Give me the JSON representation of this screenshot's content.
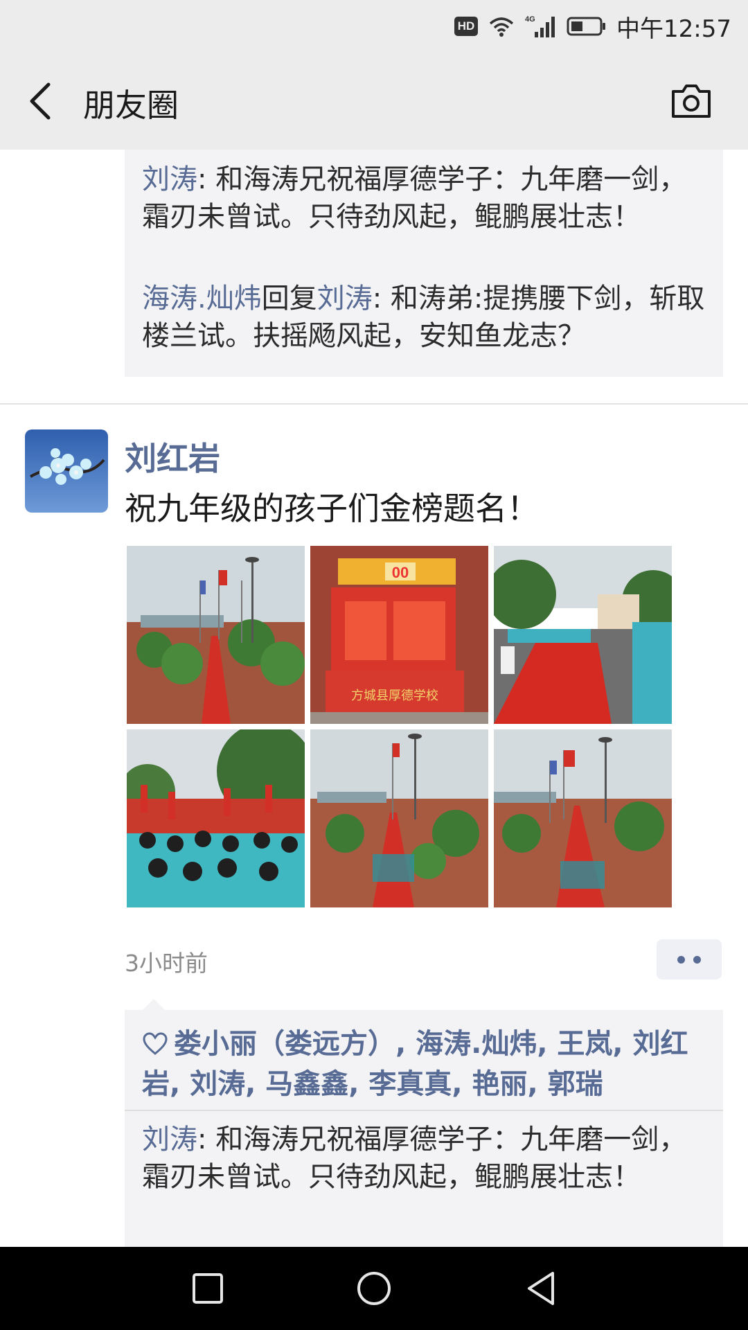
{
  "status_bar": {
    "hd": "HD",
    "network": "4G",
    "time": "中午12:57"
  },
  "nav": {
    "title": "朋友圈"
  },
  "prev_post": {
    "comments": [
      {
        "user": "刘涛",
        "text": ": 和海涛兄祝福厚德学子：九年磨一剑，霜刃未曾试。只待劲风起，鲲鹏展壮志！"
      },
      {
        "user": "海涛.灿炜",
        "reply_word": "回复",
        "reply_to": "刘涛",
        "text": ": 和涛弟:提携腰下剑，斩取楼兰试。扶摇飏风起，安知鱼龙志？"
      }
    ]
  },
  "post": {
    "author": "刘红岩",
    "text": "祝九年级的孩子们金榜题名！",
    "timestamp": "3小时前",
    "photo_texts": {
      "countdown": "00",
      "school": "方城县厚德学校"
    },
    "likes": "娄小丽（娄远方）, 海涛.灿炜, 王岚, 刘红岩, 刘涛, 马鑫鑫, 李真真, 艳丽, 郭瑞",
    "comment": {
      "user": "刘涛",
      "text": ": 和海涛兄祝福厚德学子：九年磨一剑，霜刃未曾试。只待劲风起，鲲鹏展壮志！"
    }
  },
  "colors": {
    "link": "#576b95",
    "bar_bg": "#ececec",
    "comment_bg": "#f3f3f5"
  }
}
